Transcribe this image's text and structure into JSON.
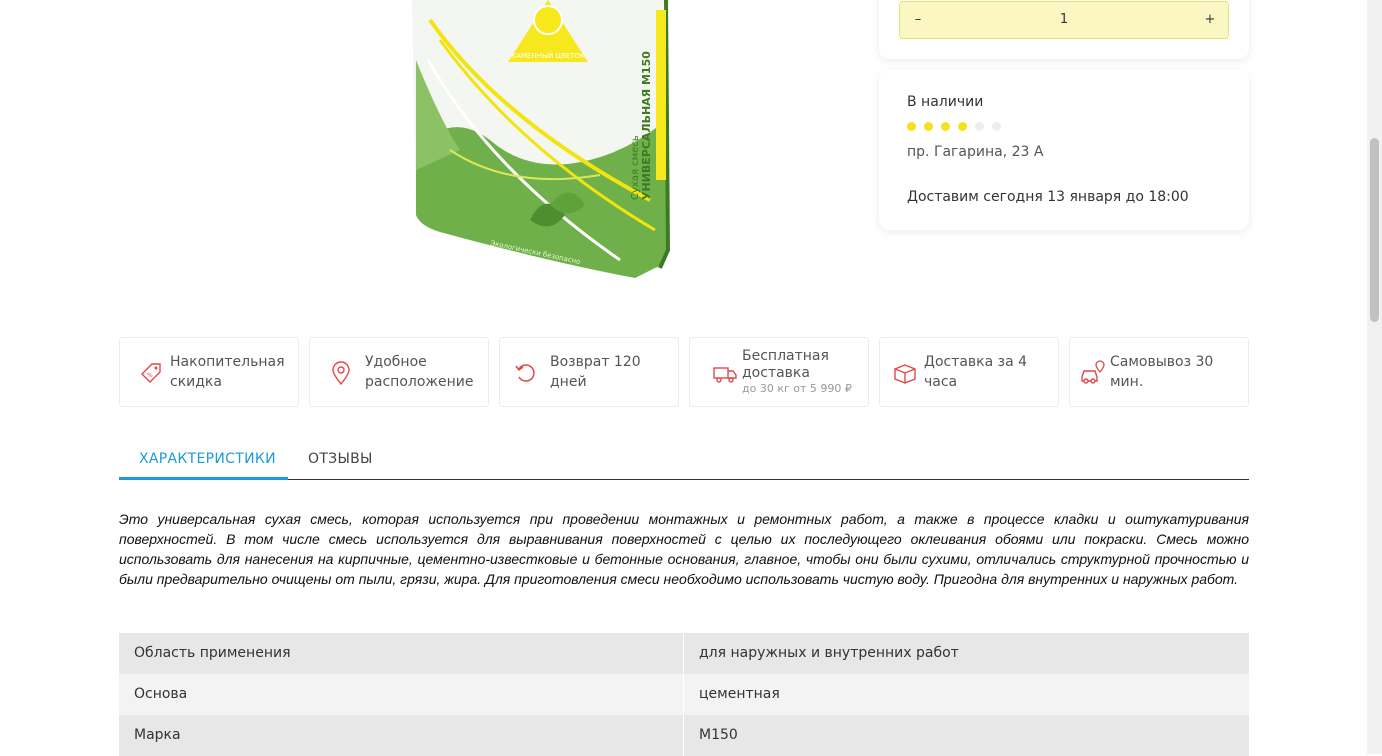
{
  "quantity": {
    "minus": "–",
    "value": "1",
    "plus": "+"
  },
  "stock": {
    "title": "В наличии",
    "rating_level": 4,
    "rating_max": 6,
    "address": "пр. Гагарина, 23 А",
    "delivery": "Доставим сегодня 13 января до 18:00"
  },
  "features": [
    {
      "icon": "discount-tag-icon",
      "label": "Накопительная скидка"
    },
    {
      "icon": "location-pin-icon",
      "label": "Удобное расположение"
    },
    {
      "icon": "return-arrow-icon",
      "label": "Возврат 120 дней"
    },
    {
      "icon": "delivery-truck-icon",
      "label": "Бесплатная доставка",
      "sub": "до 30 кг от 5 990 ₽"
    },
    {
      "icon": "package-box-icon",
      "label": "Доставка за 4 часа"
    },
    {
      "icon": "car-pickup-icon",
      "label": "Самовывоз 30 мин."
    }
  ],
  "tabs": {
    "characteristics": "ХАРАКТЕРИСТИКИ",
    "reviews": "ОТЗЫВЫ"
  },
  "description": "Это универсальная сухая смесь, которая используется при проведении монтажных и ремонтных работ, а также в процессе кладки и оштукатуривания поверхностей. В том числе смесь используется для выравнивания поверхностей с целью их последующего оклеивания обоями или покраски. Смесь можно использовать для нанесения на кирпичные, цементно-известковые и бетонные основания, главное, чтобы они были сухими, отличались структурной прочностью и были предварительно очищены от пыли, грязи, жира. Для приготовления смеси необходимо использовать чистую воду. Пригодна для внутренних и наружных работ.",
  "specs": [
    {
      "key": "Область применения",
      "value": "для наружных и внутренних работ"
    },
    {
      "key": "Основа",
      "value": "цементная"
    },
    {
      "key": "Марка",
      "value": "М150"
    }
  ],
  "product_image": {
    "brand": "КАМЕННЫЙ ЦВЕТОК",
    "type": "Сухая смесь",
    "name": "УНИВЕРСАЛЬНАЯ М150",
    "eco": "Экологически безопасно"
  },
  "colors": {
    "accent": "#1d9bd8",
    "qty_bg": "#fbf7c2",
    "star_on": "#f4e21c",
    "icon_red": "#e2484a",
    "pack_green": "#6fb04a"
  }
}
